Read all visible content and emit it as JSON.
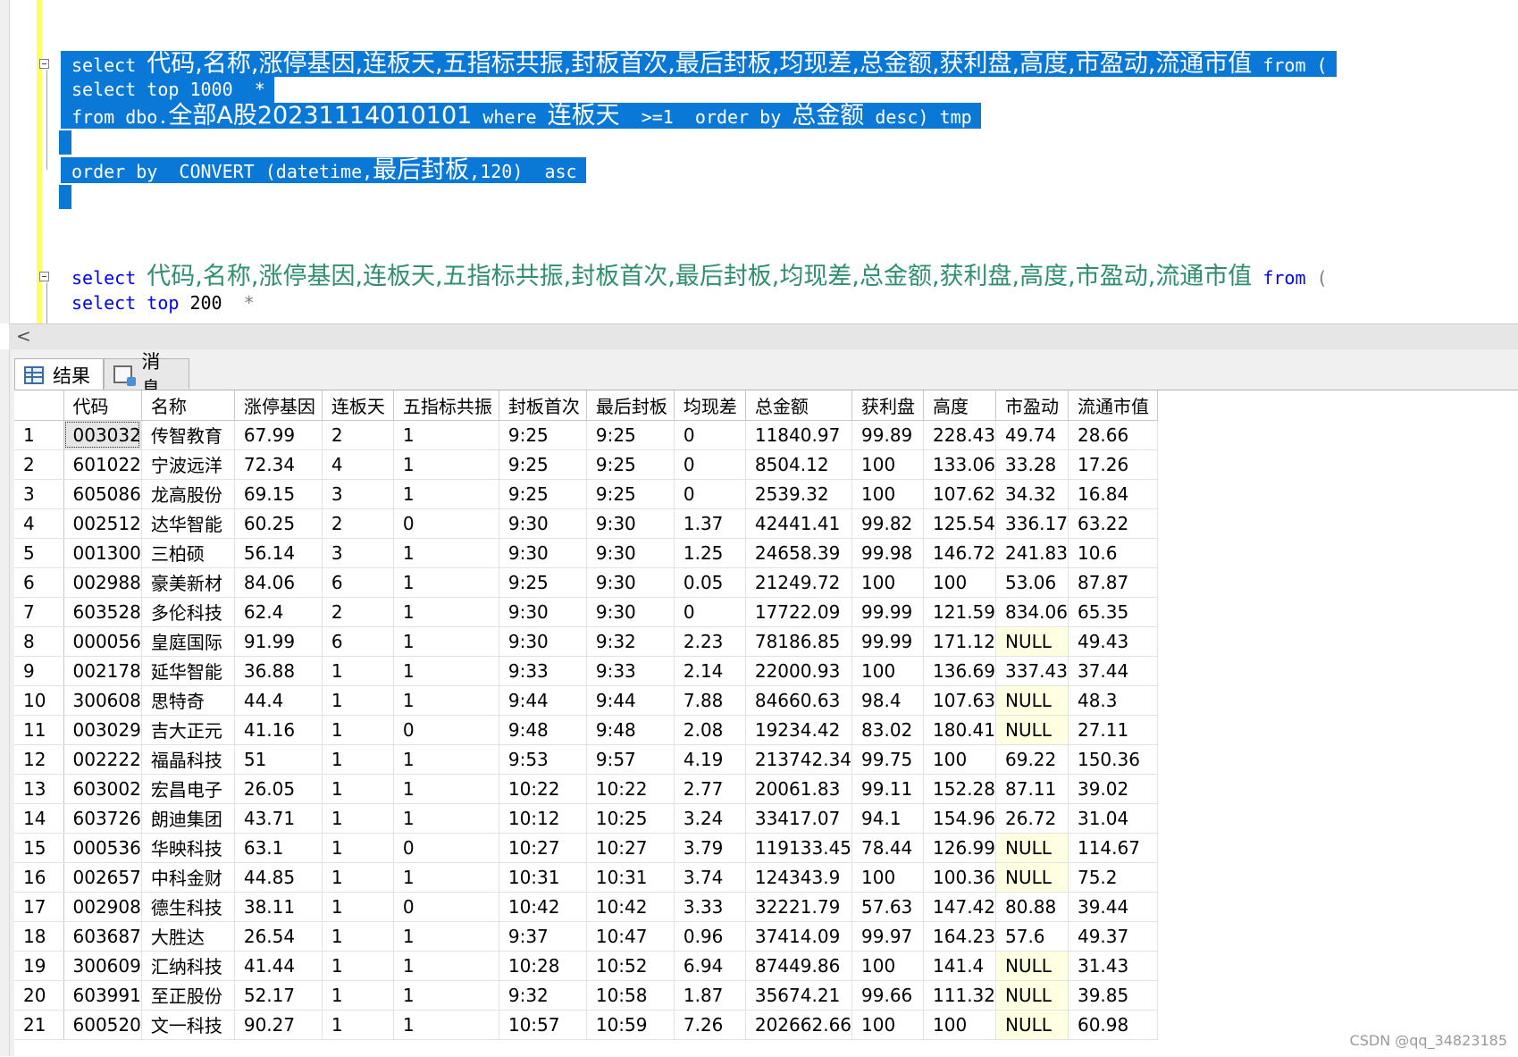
{
  "editor": {
    "selected_lines": [
      [
        "select ",
        "代码,名称,涨停基因,连板天,五指标共振,封板首次,最后封板,均现差,总金额,获利盘,高度,市盈动,流通市值",
        " from ("
      ],
      [
        "select top 1000  *",
        "",
        ""
      ],
      [
        "from dbo.",
        "全部A股20231114010101",
        " where "
      ],
      [
        "",
        "",
        ""
      ],
      [
        "order by  CONVERT (datetime,",
        "最后封板",
        ",120)  asc"
      ]
    ],
    "line3_extra_cn1": "连板天",
    "line3_extra_mid": "  >=1  order by ",
    "line3_extra_cn2": "总金额",
    "line3_extra_end": " desc) tmp",
    "line6": {
      "kw": "select",
      "cols": "代码,名称,涨停基因,连板天,五指标共振,封板首次,最后封板,均现差,总金额,获利盘,高度,市盈动,流通市值",
      "kw2": "from",
      "paren": "("
    },
    "line7": {
      "kw": "select top",
      "num": "200",
      "star": "*"
    }
  },
  "scrollbar": {
    "left_arrow": "<"
  },
  "tabs": [
    {
      "label": "结果",
      "icon": "grid-icon",
      "active": true
    },
    {
      "label": "消息",
      "icon": "message-icon",
      "active": false
    }
  ],
  "grid": {
    "columns": [
      "代码",
      "名称",
      "涨停基因",
      "连板天",
      "五指标共振",
      "封板首次",
      "最后封板",
      "均现差",
      "总金额",
      "获利盘",
      "高度",
      "市盈动",
      "流通市值"
    ],
    "null_color": "#ffffe1",
    "rows": [
      [
        "1",
        "003032",
        "传智教育",
        "67.99",
        "2",
        "1",
        "9:25",
        "9:25",
        "0",
        "11840.97",
        "99.89",
        "228.43",
        "49.74",
        "28.66"
      ],
      [
        "2",
        "601022",
        "宁波远洋",
        "72.34",
        "4",
        "1",
        "9:25",
        "9:25",
        "0",
        "8504.12",
        "100",
        "133.06",
        "33.28",
        "17.26"
      ],
      [
        "3",
        "605086",
        "龙高股份",
        "69.15",
        "3",
        "1",
        "9:25",
        "9:25",
        "0",
        "2539.32",
        "100",
        "107.62",
        "34.32",
        "16.84"
      ],
      [
        "4",
        "002512",
        "达华智能",
        "60.25",
        "2",
        "0",
        "9:30",
        "9:30",
        "1.37",
        "42441.41",
        "99.82",
        "125.54",
        "336.17",
        "63.22"
      ],
      [
        "5",
        "001300",
        "三柏硕",
        "56.14",
        "3",
        "1",
        "9:30",
        "9:30",
        "1.25",
        "24658.39",
        "99.98",
        "146.72",
        "241.83",
        "10.6"
      ],
      [
        "6",
        "002988",
        "豪美新材",
        "84.06",
        "6",
        "1",
        "9:25",
        "9:30",
        "0.05",
        "21249.72",
        "100",
        "100",
        "53.06",
        "87.87"
      ],
      [
        "7",
        "603528",
        "多伦科技",
        "62.4",
        "2",
        "1",
        "9:30",
        "9:30",
        "0",
        "17722.09",
        "99.99",
        "121.59",
        "834.06",
        "65.35"
      ],
      [
        "8",
        "000056",
        "皇庭国际",
        "91.99",
        "6",
        "1",
        "9:30",
        "9:32",
        "2.23",
        "78186.85",
        "99.99",
        "171.12",
        "NULL",
        "49.43"
      ],
      [
        "9",
        "002178",
        "延华智能",
        "36.88",
        "1",
        "1",
        "9:33",
        "9:33",
        "2.14",
        "22000.93",
        "100",
        "136.69",
        "337.43",
        "37.44"
      ],
      [
        "10",
        "300608",
        "思特奇",
        "44.4",
        "1",
        "1",
        "9:44",
        "9:44",
        "7.88",
        "84660.63",
        "98.4",
        "107.63",
        "NULL",
        "48.3"
      ],
      [
        "11",
        "003029",
        "吉大正元",
        "41.16",
        "1",
        "0",
        "9:48",
        "9:48",
        "2.08",
        "19234.42",
        "83.02",
        "180.41",
        "NULL",
        "27.11"
      ],
      [
        "12",
        "002222",
        "福晶科技",
        "51",
        "1",
        "1",
        "9:53",
        "9:57",
        "4.19",
        "213742.34",
        "99.75",
        "100",
        "69.22",
        "150.36"
      ],
      [
        "13",
        "603002",
        "宏昌电子",
        "26.05",
        "1",
        "1",
        "10:22",
        "10:22",
        "2.77",
        "20061.83",
        "99.11",
        "152.28",
        "87.11",
        "39.02"
      ],
      [
        "14",
        "603726",
        "朗迪集团",
        "43.71",
        "1",
        "1",
        "10:12",
        "10:25",
        "3.24",
        "33417.07",
        "94.1",
        "154.96",
        "26.72",
        "31.04"
      ],
      [
        "15",
        "000536",
        "华映科技",
        "63.1",
        "1",
        "0",
        "10:27",
        "10:27",
        "3.79",
        "119133.45",
        "78.44",
        "126.99",
        "NULL",
        "114.67"
      ],
      [
        "16",
        "002657",
        "中科金财",
        "44.85",
        "1",
        "1",
        "10:31",
        "10:31",
        "3.74",
        "124343.9",
        "100",
        "100.36",
        "NULL",
        "75.2"
      ],
      [
        "17",
        "002908",
        "德生科技",
        "38.11",
        "1",
        "0",
        "10:42",
        "10:42",
        "3.33",
        "32221.79",
        "57.63",
        "147.42",
        "80.88",
        "39.44"
      ],
      [
        "18",
        "603687",
        "大胜达",
        "26.54",
        "1",
        "1",
        "9:37",
        "10:47",
        "0.96",
        "37414.09",
        "99.97",
        "164.23",
        "57.6",
        "49.37"
      ],
      [
        "19",
        "300609",
        "汇纳科技",
        "41.44",
        "1",
        "1",
        "10:28",
        "10:52",
        "6.94",
        "87449.86",
        "100",
        "141.4",
        "NULL",
        "31.43"
      ],
      [
        "20",
        "603991",
        "至正股份",
        "52.17",
        "1",
        "1",
        "9:32",
        "10:58",
        "1.87",
        "35674.21",
        "99.66",
        "111.32",
        "NULL",
        "39.85"
      ],
      [
        "21",
        "600520",
        "文一科技",
        "90.27",
        "1",
        "1",
        "10:57",
        "10:59",
        "7.26",
        "202662.66",
        "100",
        "100",
        "NULL",
        "60.98"
      ]
    ]
  },
  "watermark": "CSDN @qq_34823185"
}
